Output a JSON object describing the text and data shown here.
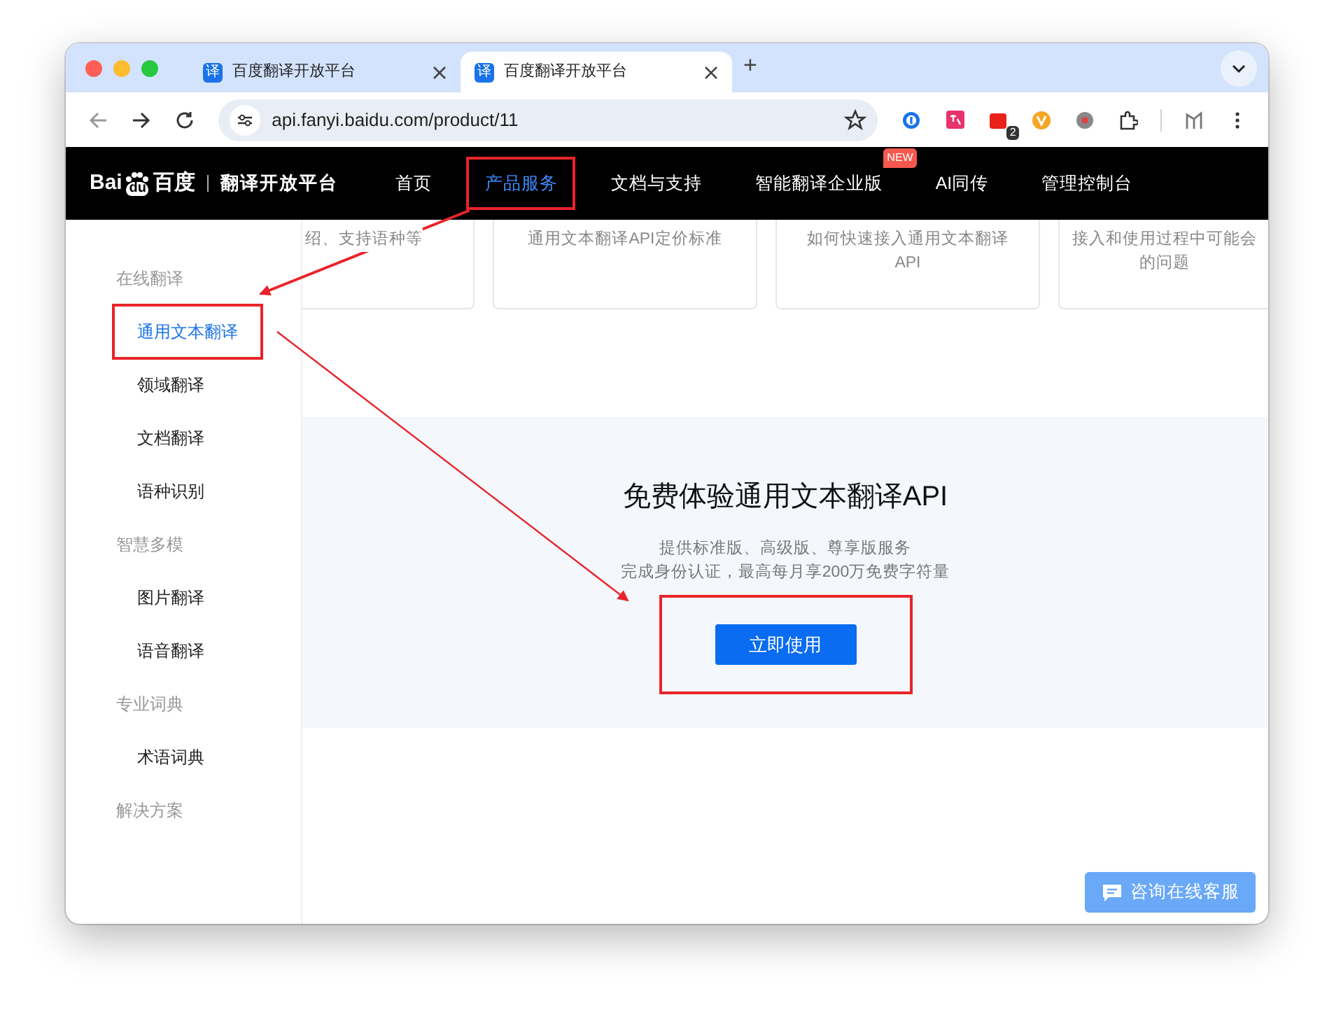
{
  "browser": {
    "tabs": [
      {
        "favicon_glyph": "译",
        "title": "百度翻译开放平台",
        "selected": false
      },
      {
        "favicon_glyph": "译",
        "title": "百度翻译开放平台",
        "selected": true
      }
    ],
    "new_tab": "+",
    "url": "api.fanyi.baidu.com/product/11",
    "extension_badge": "2"
  },
  "site_nav": {
    "logo": {
      "left": "Bai",
      "paw_text": "du",
      "right": "百度",
      "platform": "翻译开放平台"
    },
    "items": [
      {
        "label": "首页",
        "selected": false,
        "highlighted": false
      },
      {
        "label": "产品服务",
        "selected": true,
        "highlighted": true
      },
      {
        "label": "文档与支持",
        "selected": false,
        "highlighted": false
      },
      {
        "label": "智能翻译企业版",
        "selected": false,
        "highlighted": false,
        "badge": "NEW"
      },
      {
        "label": "AI同传",
        "selected": false,
        "highlighted": false
      },
      {
        "label": "管理控制台",
        "selected": false,
        "highlighted": false
      }
    ]
  },
  "sidebar": {
    "groups": [
      {
        "heading": "在线翻译",
        "items": [
          {
            "label": "通用文本翻译",
            "selected": true,
            "highlighted": true
          },
          {
            "label": "领域翻译",
            "selected": false,
            "highlighted": false
          },
          {
            "label": "文档翻译",
            "selected": false,
            "highlighted": false
          },
          {
            "label": "语种识别",
            "selected": false,
            "highlighted": false
          }
        ]
      },
      {
        "heading": "智慧多模",
        "items": [
          {
            "label": "图片翻译",
            "selected": false,
            "highlighted": false
          },
          {
            "label": "语音翻译",
            "selected": false,
            "highlighted": false
          }
        ]
      },
      {
        "heading": "专业词典",
        "items": [
          {
            "label": "术语词典",
            "selected": false,
            "highlighted": false
          }
        ]
      },
      {
        "heading": "解决方案"
      }
    ]
  },
  "cards": [
    {
      "description": "绍、支持语种等"
    },
    {
      "description": "通用文本翻译API定价标准"
    },
    {
      "description": "如何快速接入通用文本翻译API"
    },
    {
      "description": "接入和使用过程中可能会",
      "description_2": "的问题"
    }
  ],
  "promo": {
    "title": "免费体验通用文本翻译API",
    "lines": [
      "提供标准版、高级版、尊享版服务",
      "完成身份认证，最高每月享200万免费字符量"
    ],
    "button": "立即使用",
    "button_highlighted": true
  },
  "chat_button": "咨询在线客服"
}
